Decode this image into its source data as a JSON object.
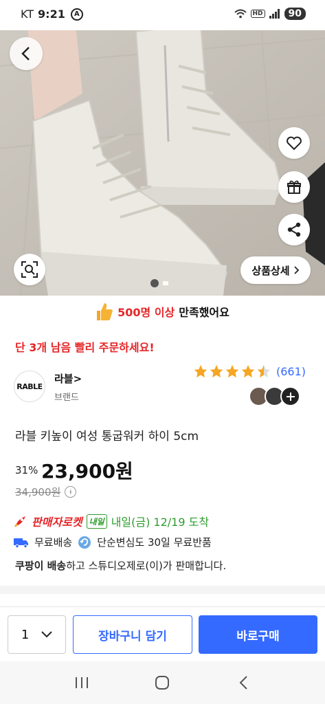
{
  "status_bar": {
    "carrier": "KT",
    "time": "9:21",
    "hd_label": "HD",
    "battery": "90"
  },
  "hero": {
    "detail_button": "상품상세",
    "icons": [
      "back-arrow-icon",
      "heart-icon",
      "gift-icon",
      "share-icon",
      "lens-search-icon"
    ]
  },
  "satisfaction": {
    "highlight": "500명 이상",
    "text": "만족했어요"
  },
  "stock_notice": "단 3개 남음 빨리 주문하세요!",
  "brand": {
    "logo_text": "RABLE",
    "name": "라블>",
    "subtitle": "브랜드",
    "rating": 4.5,
    "review_count": "(661)"
  },
  "product": {
    "title": "라블 키높이 여성 통굽워커 하이 5cm",
    "discount": "31%",
    "price": "23,900원",
    "original_price": "34,900원",
    "info_symbol": "i"
  },
  "delivery": {
    "rocket_label": "판매자로켓",
    "badge": "내일",
    "arrival": "내일(금) 12/19 도착",
    "free_shipping": "무료배송",
    "free_return": "단순변심도 30일 무료반품",
    "seller_prefix": "쿠팡이 배송",
    "seller_text": "하고 스튜디오제로(이)가 판매합니다."
  },
  "bottom_bar": {
    "quantity": "1",
    "cart_label": "장바구니 담기",
    "buy_label": "바로구매"
  },
  "colors": {
    "accent_blue": "#346aff",
    "red": "#e52528",
    "green": "#2e9b2e",
    "star": "#f5a623"
  }
}
